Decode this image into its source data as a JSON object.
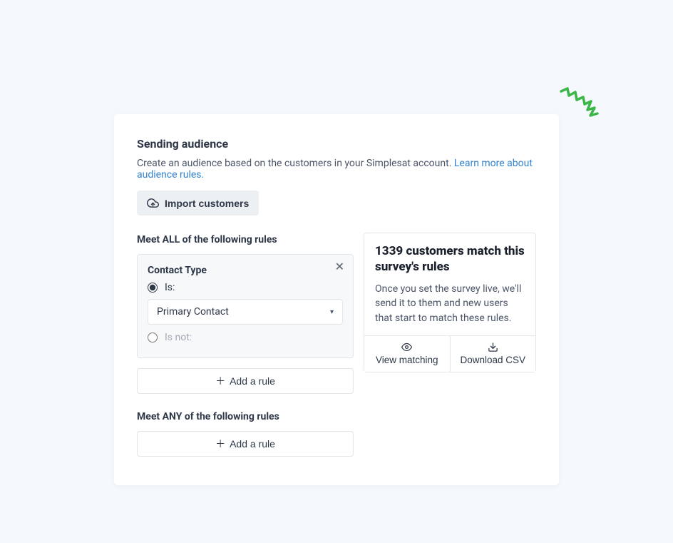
{
  "header": {
    "title": "Sending audience",
    "description": "Create an audience based on the customers in your Simplesat account. ",
    "learn_more_text": "Learn more about audience rules.",
    "import_button": "Import customers"
  },
  "all_rules": {
    "label": "Meet ALL of the following rules",
    "rule": {
      "title": "Contact Type",
      "option_is": "Is:",
      "option_is_not": "Is not:",
      "selected_value": "Primary Contact"
    },
    "add_rule": "Add a rule"
  },
  "any_rules": {
    "label": "Meet ANY of the following rules",
    "add_rule": "Add a rule"
  },
  "match": {
    "title": "1339 customers match this survey's rules",
    "description": "Once you set the survey live, we'll send it to them and new users that start to match these rules.",
    "view_label": "View matching",
    "download_label": "Download CSV"
  }
}
